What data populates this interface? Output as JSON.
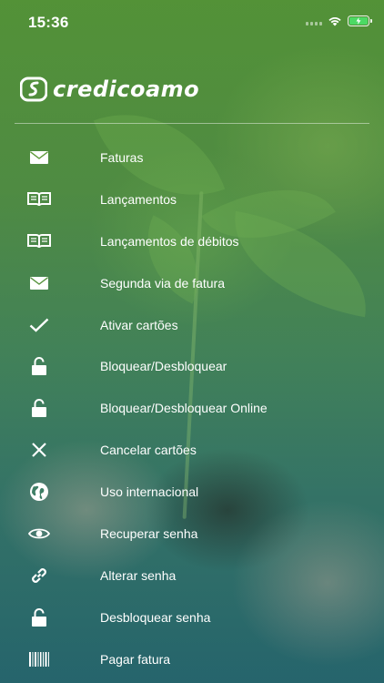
{
  "status_bar": {
    "time": "15:36"
  },
  "brand": {
    "name": "credicoamo"
  },
  "menu": {
    "items": [
      {
        "label": "Faturas",
        "icon": "envelope-icon"
      },
      {
        "label": "Lançamentos",
        "icon": "book-icon"
      },
      {
        "label": "Lançamentos de débitos",
        "icon": "book-icon"
      },
      {
        "label": "Segunda via de fatura",
        "icon": "envelope-icon"
      },
      {
        "label": "Ativar cartões",
        "icon": "check-icon"
      },
      {
        "label": "Bloquear/Desbloquear",
        "icon": "lock-icon"
      },
      {
        "label": "Bloquear/Desbloquear Online",
        "icon": "lock-icon"
      },
      {
        "label": "Cancelar cartões",
        "icon": "close-icon"
      },
      {
        "label": "Uso internacional",
        "icon": "globe-icon"
      },
      {
        "label": "Recuperar senha",
        "icon": "eye-icon"
      },
      {
        "label": "Alterar senha",
        "icon": "link-icon"
      },
      {
        "label": "Desbloquear senha",
        "icon": "lock-icon"
      },
      {
        "label": "Pagar fatura",
        "icon": "barcode-icon"
      }
    ]
  },
  "colors": {
    "text": "#ffffff",
    "battery": "#4cd964",
    "background_top": "#5f9a3a",
    "background_bottom": "#2f6a70"
  }
}
